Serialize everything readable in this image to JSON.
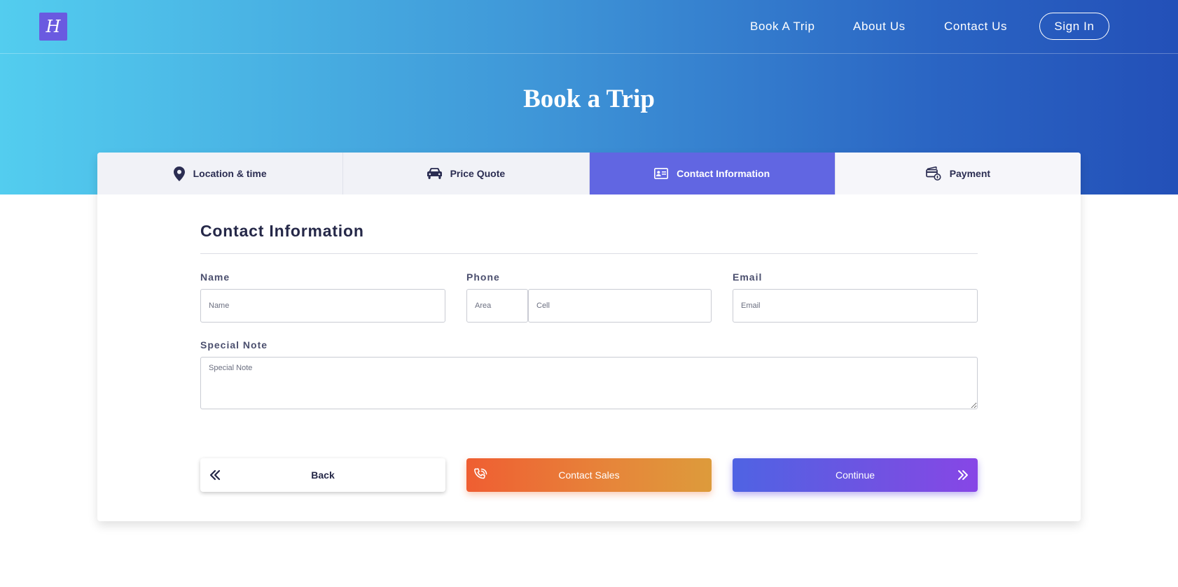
{
  "header": {
    "logo_text": "H",
    "nav": {
      "book_trip": "Book A Trip",
      "about": "About Us",
      "contact": "Contact Us",
      "sign_in": "Sign In"
    }
  },
  "page": {
    "title": "Book a Trip"
  },
  "steps": [
    {
      "label": "Location & time",
      "icon": "location-pin-icon"
    },
    {
      "label": "Price Quote",
      "icon": "car-icon"
    },
    {
      "label": "Contact Information",
      "icon": "contact-card-icon",
      "active": true
    },
    {
      "label": "Payment",
      "icon": "payment-icon"
    }
  ],
  "form": {
    "title": "Contact Information",
    "name": {
      "label": "Name",
      "placeholder": "Name",
      "value": ""
    },
    "phone": {
      "label": "Phone",
      "area_placeholder": "Area",
      "cell_placeholder": "Cell",
      "area_value": "",
      "cell_value": ""
    },
    "email": {
      "label": "Email",
      "placeholder": "Email",
      "value": ""
    },
    "note": {
      "label": "Special Note",
      "placeholder": "Special Note",
      "value": ""
    }
  },
  "buttons": {
    "back": "Back",
    "contact_sales": "Contact Sales",
    "continue": "Continue"
  },
  "colors": {
    "active_step": "#6166e2",
    "hero_start": "#53cdef",
    "hero_end": "#2350b8",
    "sales_start": "#ef5e32",
    "sales_end": "#dd9b3b",
    "continue_start": "#4f63e3",
    "continue_end": "#8746e6"
  }
}
